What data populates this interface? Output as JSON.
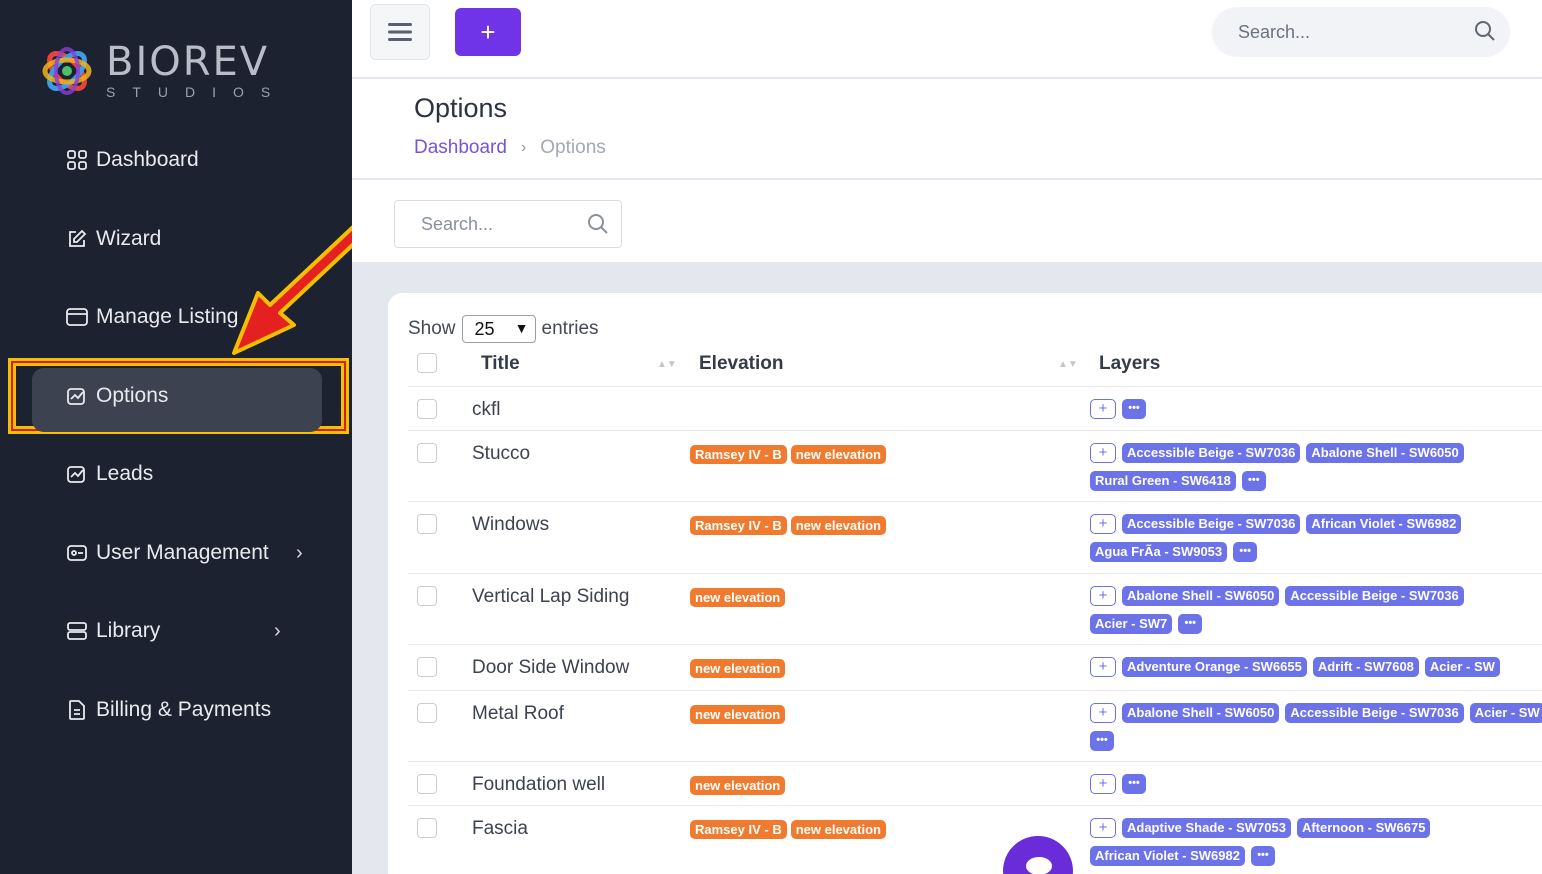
{
  "brand": {
    "name": "BIOREV",
    "sub": "STUDIOS"
  },
  "sidebar": {
    "items": [
      {
        "label": "Dashboard",
        "icon": "grid-icon"
      },
      {
        "label": "Wizard",
        "icon": "edit-icon"
      },
      {
        "label": "Manage Listing",
        "icon": "folder-icon"
      },
      {
        "label": "Options",
        "icon": "chart-icon",
        "active": true
      },
      {
        "label": "Leads",
        "icon": "chart-icon"
      },
      {
        "label": "User Management",
        "icon": "id-card-icon"
      },
      {
        "label": "Library",
        "icon": "database-icon"
      },
      {
        "label": "Billing & Payments",
        "icon": "invoice-icon"
      }
    ],
    "chevron": "›"
  },
  "topbar": {
    "add_label": "+",
    "search_placeholder": "Search..."
  },
  "page": {
    "title": "Options",
    "breadcrumb": {
      "home": "Dashboard",
      "sep": "›",
      "current": "Options"
    },
    "filter_placeholder": "Search..."
  },
  "table": {
    "show_label": "Show",
    "entries_value": "25",
    "entries_label": "entries",
    "columns": [
      "Title",
      "Elevation",
      "Layers"
    ],
    "rows": [
      {
        "title": "ckfl",
        "elevation": [],
        "layers": []
      },
      {
        "title": "Stucco",
        "elevation": [
          "Ramsey IV - B",
          "new elevation"
        ],
        "layers": [
          "Accessible Beige - SW7036",
          "Abalone Shell - SW6050",
          "Rural Green - SW6418"
        ]
      },
      {
        "title": "Windows",
        "elevation": [
          "Ramsey IV - B",
          "new elevation"
        ],
        "layers": [
          "Accessible Beige - SW7036",
          "African Violet - SW6982",
          "Agua FrÃ­a - SW9053"
        ]
      },
      {
        "title": "Vertical Lap Siding",
        "elevation": [
          "new elevation"
        ],
        "layers": [
          "Abalone Shell - SW6050",
          "Accessible Beige - SW7036",
          "Acier - SW7"
        ]
      },
      {
        "title": "Door Side Window",
        "elevation": [
          "new elevation"
        ],
        "layers": [
          "Adventure Orange - SW6655",
          "Adrift - SW7608",
          "Acier - SW"
        ]
      },
      {
        "title": "Metal Roof",
        "elevation": [
          "new elevation"
        ],
        "layers": [
          "Abalone Shell - SW6050",
          "Accessible Beige - SW7036",
          "Acier - SW"
        ]
      },
      {
        "title": "Foundation well",
        "elevation": [
          "new elevation"
        ],
        "layers": []
      },
      {
        "title": "Fascia",
        "elevation": [
          "Ramsey IV - B",
          "new elevation"
        ],
        "layers": [
          "Adaptive Shade - SW7053",
          "Afternoon - SW6675",
          "African Violet - SW6982"
        ]
      }
    ],
    "add_symbol": "+",
    "more_symbol": "•••"
  },
  "colors": {
    "accent": "#7034e8",
    "sidebar_bg": "#1d2230",
    "elevation_pill": "#f07b2e",
    "layer_pill": "#6c72e8",
    "highlight": "#f6c000"
  }
}
